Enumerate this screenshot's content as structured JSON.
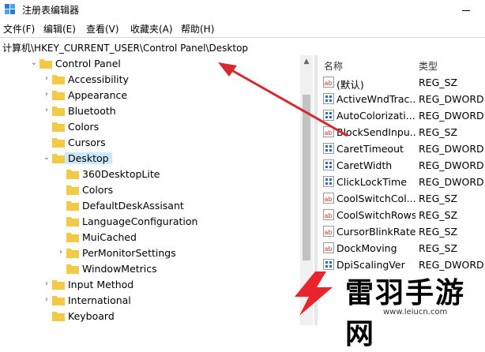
{
  "window": {
    "title": "注册表编辑器"
  },
  "menu": [
    "文件(F)",
    "编辑(E)",
    "查看(V)",
    "收藏夹(A)",
    "帮助(H)"
  ],
  "address": "计算机\\HKEY_CURRENT_USER\\Control Panel\\Desktop",
  "tree": [
    {
      "label": "Control Panel",
      "level": 0,
      "expanded": true
    },
    {
      "label": "Accessibility",
      "level": 1,
      "expandable": true
    },
    {
      "label": "Appearance",
      "level": 1,
      "expandable": true
    },
    {
      "label": "Bluetooth",
      "level": 1,
      "expandable": true
    },
    {
      "label": "Colors",
      "level": 1,
      "expandable": false
    },
    {
      "label": "Cursors",
      "level": 1,
      "expandable": false
    },
    {
      "label": "Desktop",
      "level": 1,
      "expanded": true,
      "selected": true
    },
    {
      "label": "360DesktopLite",
      "level": 2,
      "expandable": false
    },
    {
      "label": "Colors",
      "level": 2,
      "expandable": false
    },
    {
      "label": "DefaultDeskAssisant",
      "level": 2,
      "expandable": false
    },
    {
      "label": "LanguageConfiguration",
      "level": 2,
      "expandable": false
    },
    {
      "label": "MuiCached",
      "level": 2,
      "expandable": false
    },
    {
      "label": "PerMonitorSettings",
      "level": 2,
      "expandable": true
    },
    {
      "label": "WindowMetrics",
      "level": 2,
      "expandable": false
    },
    {
      "label": "Input Method",
      "level": 1,
      "expandable": true
    },
    {
      "label": "International",
      "level": 1,
      "expandable": true
    },
    {
      "label": "Keyboard",
      "level": 1,
      "expandable": false
    }
  ],
  "columns": {
    "name": "名称",
    "type": "类型"
  },
  "values": [
    {
      "name": "(默认)",
      "type": "REG_SZ",
      "icon": "string-value-icon"
    },
    {
      "name": "ActiveWndTrac...",
      "type": "REG_DWORD",
      "icon": "binary-value-icon"
    },
    {
      "name": "AutoColorizati...",
      "type": "REG_DWORD",
      "icon": "binary-value-icon"
    },
    {
      "name": "BlockSendInpu...",
      "type": "REG_SZ",
      "icon": "string-value-icon"
    },
    {
      "name": "CaretTimeout",
      "type": "REG_DWORD",
      "icon": "binary-value-icon"
    },
    {
      "name": "CaretWidth",
      "type": "REG_DWORD",
      "icon": "binary-value-icon"
    },
    {
      "name": "ClickLockTime",
      "type": "REG_DWORD",
      "icon": "binary-value-icon"
    },
    {
      "name": "CoolSwitchCol...",
      "type": "REG_SZ",
      "icon": "string-value-icon"
    },
    {
      "name": "CoolSwitchRows",
      "type": "REG_SZ",
      "icon": "string-value-icon"
    },
    {
      "name": "CursorBlinkRate",
      "type": "REG_SZ",
      "icon": "string-value-icon"
    },
    {
      "name": "DockMoving",
      "type": "REG_SZ",
      "icon": "string-value-icon"
    },
    {
      "name": "DpiScalingVer",
      "type": "REG_DWORD",
      "icon": "binary-value-icon"
    }
  ],
  "watermark": {
    "text": "雷羽手游网",
    "url": "www.leiucn.com"
  },
  "colors": {
    "folder": "#f3c948",
    "selected": "#cce8ff",
    "arrow": "#d9282f",
    "logo": "#e8242c"
  }
}
